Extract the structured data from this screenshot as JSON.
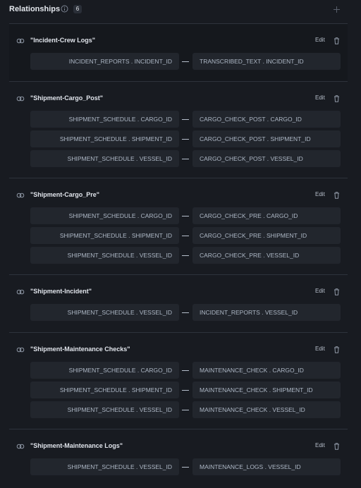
{
  "header": {
    "title": "Relationships",
    "count": "6"
  },
  "icons": {
    "info": "info-icon",
    "add": "plus-icon",
    "link": "link-icon",
    "delete": "trash-icon"
  },
  "colors": {
    "background": "#181b21",
    "field": "#22262d",
    "text": "#aeb8c6"
  },
  "relationships": [
    {
      "name": "\"Incident-Crew Logs\"",
      "edit_label": "Edit",
      "mappings": [
        {
          "left": "INCIDENT_REPORTS . INCIDENT_ID",
          "right": "TRANSCRIBED_TEXT . INCIDENT_ID"
        }
      ]
    },
    {
      "name": "\"Shipment-Cargo_Post\"",
      "edit_label": "Edit",
      "mappings": [
        {
          "left": "SHIPMENT_SCHEDULE . CARGO_ID",
          "right": "CARGO_CHECK_POST . CARGO_ID"
        },
        {
          "left": "SHIPMENT_SCHEDULE . SHIPMENT_ID",
          "right": "CARGO_CHECK_POST . SHIPMENT_ID"
        },
        {
          "left": "SHIPMENT_SCHEDULE . VESSEL_ID",
          "right": "CARGO_CHECK_POST . VESSEL_ID"
        }
      ]
    },
    {
      "name": "\"Shipment-Cargo_Pre\"",
      "edit_label": "Edit",
      "mappings": [
        {
          "left": "SHIPMENT_SCHEDULE . CARGO_ID",
          "right": "CARGO_CHECK_PRE . CARGO_ID"
        },
        {
          "left": "SHIPMENT_SCHEDULE . SHIPMENT_ID",
          "right": "CARGO_CHECK_PRE . SHIPMENT_ID"
        },
        {
          "left": "SHIPMENT_SCHEDULE . VESSEL_ID",
          "right": "CARGO_CHECK_PRE . VESSEL_ID"
        }
      ]
    },
    {
      "name": "\"Shipment-Incident\"",
      "edit_label": "Edit",
      "mappings": [
        {
          "left": "SHIPMENT_SCHEDULE . VESSEL_ID",
          "right": "INCIDENT_REPORTS . VESSEL_ID"
        }
      ]
    },
    {
      "name": "\"Shipment-Maintenance Checks\"",
      "edit_label": "Edit",
      "mappings": [
        {
          "left": "SHIPMENT_SCHEDULE . CARGO_ID",
          "right": "MAINTENANCE_CHECK . CARGO_ID"
        },
        {
          "left": "SHIPMENT_SCHEDULE . SHIPMENT_ID",
          "right": "MAINTENANCE_CHECK . SHIPMENT_ID"
        },
        {
          "left": "SHIPMENT_SCHEDULE . VESSEL_ID",
          "right": "MAINTENANCE_CHECK . VESSEL_ID"
        }
      ]
    },
    {
      "name": "\"Shipment-Maintenance Logs\"",
      "edit_label": "Edit",
      "mappings": [
        {
          "left": "SHIPMENT_SCHEDULE . VESSEL_ID",
          "right": "MAINTENANCE_LOGS . VESSEL_ID"
        }
      ]
    }
  ]
}
